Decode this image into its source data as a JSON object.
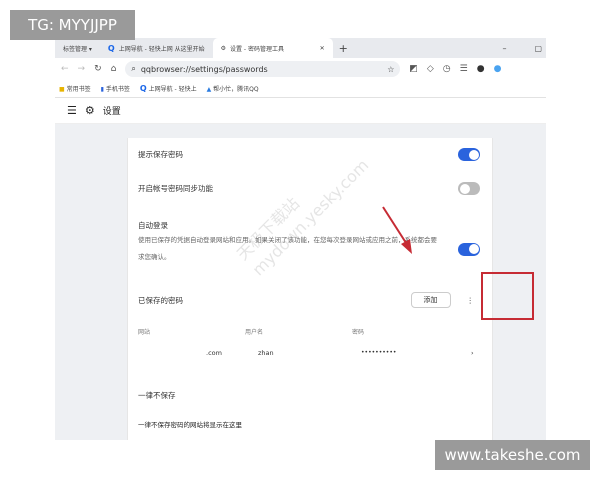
{
  "overlays": {
    "tg": "TG: MYYJJPP",
    "site": "www.takeshe.com"
  },
  "tabs": [
    {
      "label": "标签管理 ▾"
    },
    {
      "label": "上网导航 - 轻快上网 从这里开始",
      "icon": "qq-browser-icon"
    },
    {
      "label": "设置 - 密码管理工具",
      "icon": "gear-icon",
      "active": true
    }
  ],
  "new_tab": "+",
  "address": {
    "url": "qqbrowser://settings/passwords"
  },
  "bookmarks": [
    {
      "label": "常用书签"
    },
    {
      "label": "手机书签"
    },
    {
      "label": "上网导航 - 轻快上"
    },
    {
      "label": "帮小忙，腾讯QQ"
    }
  ],
  "settings": {
    "title": "设置"
  },
  "options": [
    {
      "label": "提示保存密码",
      "enabled": true
    },
    {
      "label": "开启帐号密码同步功能",
      "enabled": false
    },
    {
      "label": "自动登录",
      "desc": "使用已保存的凭据自动登录网站和应用。如果关闭了该功能，在您每次登录网站或应用之前，系统都会要求您确认。",
      "enabled": true
    }
  ],
  "saved": {
    "title": "已保存的密码",
    "add": "添加",
    "more": "⋮",
    "columns": [
      "网站",
      "用户名",
      "密码"
    ],
    "rows": [
      {
        "site": ".com",
        "user": "zhan",
        "password": "••••••••••"
      }
    ]
  },
  "never": {
    "title": "一律不保存",
    "desc": "一律不保存密码的网站将显示在这里"
  },
  "watermark": "天极下载站 mydown.yesky.com",
  "colors": {
    "accent": "#2a63dd",
    "highlight": "#c62b34"
  }
}
